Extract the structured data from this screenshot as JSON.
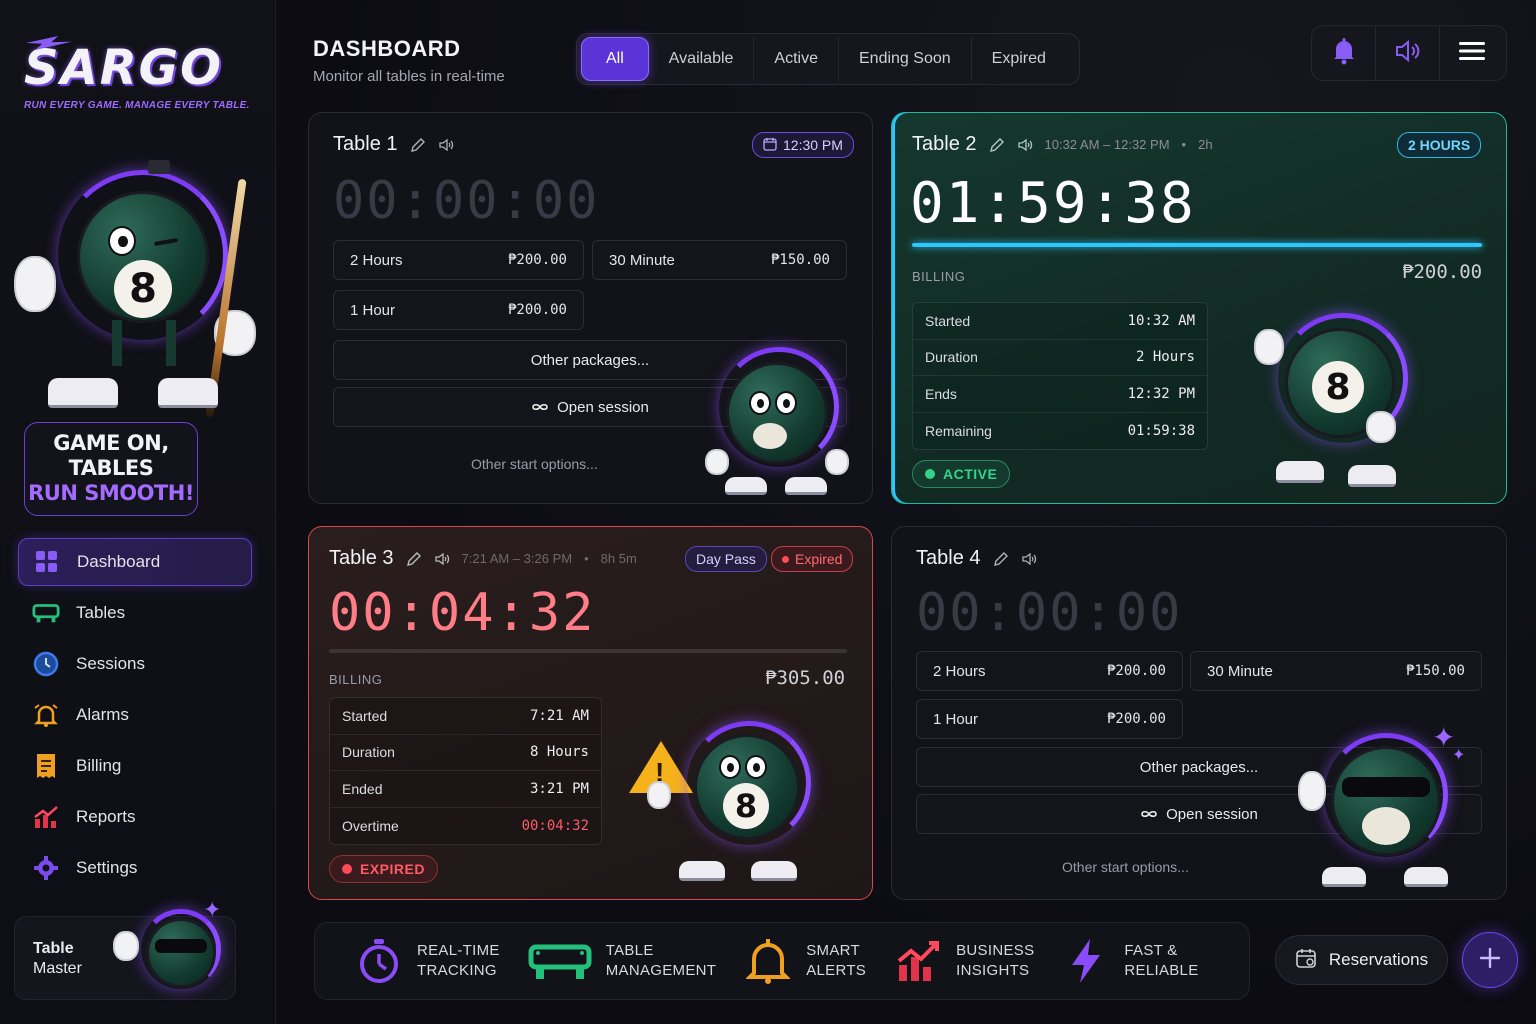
{
  "brand": {
    "name": "SARGO",
    "tagline": "RUN EVERY GAME. MANAGE EVERY TABLE."
  },
  "promo": {
    "line1": "GAME ON,",
    "line2": "TABLES",
    "line3": "RUN SMOOTH!"
  },
  "sidebar": {
    "items": [
      {
        "label": "Dashboard",
        "icon": "grid-icon",
        "active": true
      },
      {
        "label": "Tables",
        "icon": "pool-table-icon"
      },
      {
        "label": "Sessions",
        "icon": "clock-icon"
      },
      {
        "label": "Alarms",
        "icon": "alarm-icon"
      },
      {
        "label": "Billing",
        "icon": "receipt-icon"
      },
      {
        "label": "Reports",
        "icon": "chart-icon"
      },
      {
        "label": "Settings",
        "icon": "gear-icon"
      }
    ],
    "user": {
      "line1": "Table",
      "line2": "Master"
    }
  },
  "header": {
    "title": "DASHBOARD",
    "subtitle": "Monitor all tables in real-time"
  },
  "filters": [
    "All",
    "Available",
    "Active",
    "Ending Soon",
    "Expired"
  ],
  "colors": {
    "accent": "#5a34d6",
    "active_green": "#23b89a",
    "expired_red": "#d8484f",
    "progress_blue": "#2dc6ff"
  },
  "tables": {
    "t1": {
      "name": "Table 1",
      "reservation": "12:30 PM",
      "timer": "00:00:00",
      "packages": [
        {
          "label": "2 Hours",
          "price": "₱200.00"
        },
        {
          "label": "30 Minute",
          "price": "₱150.00"
        },
        {
          "label": "1 Hour",
          "price": "₱200.00"
        }
      ],
      "other_packages": "Other packages...",
      "open_session": "Open session",
      "other_start": "Other start options..."
    },
    "t2": {
      "name": "Table 2",
      "range": "10:32 AM – 12:32 PM",
      "duration_short": "2h",
      "badge": "2 HOURS",
      "timer": "01:59:38",
      "progress": 0.995,
      "billing_label": "BILLING",
      "amount": "₱200.00",
      "rows": [
        {
          "k": "Started",
          "v": "10:32 AM"
        },
        {
          "k": "Duration",
          "v": "2 Hours"
        },
        {
          "k": "Ends",
          "v": "12:32 PM"
        },
        {
          "k": "Remaining",
          "v": "01:59:38"
        }
      ],
      "status": "ACTIVE"
    },
    "t3": {
      "name": "Table 3",
      "range": "7:21 AM – 3:26 PM",
      "duration_short": "8h 5m",
      "badge1": "Day Pass",
      "badge2": "Expired",
      "timer": "00:04:32",
      "billing_label": "BILLING",
      "amount": "₱305.00",
      "rows": [
        {
          "k": "Started",
          "v": "7:21 AM"
        },
        {
          "k": "Duration",
          "v": "8 Hours"
        },
        {
          "k": "Ended",
          "v": "3:21 PM"
        },
        {
          "k": "Overtime",
          "v": "00:04:32"
        }
      ],
      "status": "EXPIRED"
    },
    "t4": {
      "name": "Table 4",
      "timer": "00:00:00",
      "packages": [
        {
          "label": "2 Hours",
          "price": "₱200.00"
        },
        {
          "label": "30 Minute",
          "price": "₱150.00"
        },
        {
          "label": "1 Hour",
          "price": "₱200.00"
        }
      ],
      "other_packages": "Other packages...",
      "open_session": "Open session",
      "other_start": "Other start options..."
    }
  },
  "features": [
    {
      "l1": "REAL-TIME",
      "l2": "TRACKING",
      "icon": "stopwatch-icon"
    },
    {
      "l1": "TABLE",
      "l2": "MANAGEMENT",
      "icon": "pool-table-icon"
    },
    {
      "l1": "SMART",
      "l2": "ALERTS",
      "icon": "bell-icon"
    },
    {
      "l1": "BUSINESS",
      "l2": "INSIGHTS",
      "icon": "chart-icon"
    },
    {
      "l1": "FAST &",
      "l2": "RELIABLE",
      "icon": "lightning-icon"
    }
  ],
  "reservations_label": "Reservations"
}
